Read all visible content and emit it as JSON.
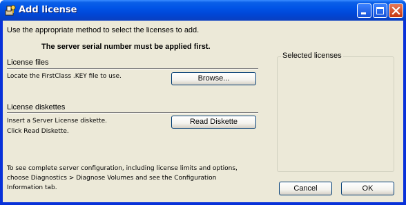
{
  "window": {
    "title": "Add license",
    "controls": {
      "minimize": "minimize",
      "maximize": "maximize",
      "close": "close"
    }
  },
  "intro": "Use the appropriate method to select the licenses to add.",
  "warning": "The server serial number must be applied first.",
  "license_files": {
    "heading": "License files",
    "instruction": "Locate the FirstClass .KEY file to use.",
    "browse_label": "Browse..."
  },
  "license_diskettes": {
    "heading": "License diskettes",
    "instruction_1": "Insert a Server License diskette.",
    "instruction_2": "Click Read Diskette.",
    "read_label": "Read Diskette"
  },
  "footer_note": {
    "line_1": "To see complete server configuration, including license limits and options,",
    "line_2": "choose Diagnostics > Diagnose Volumes and see the Configuration",
    "line_3": "Information tab."
  },
  "selected_licenses": {
    "label": "Selected licenses"
  },
  "buttons": {
    "cancel": "Cancel",
    "ok": "OK"
  },
  "colors": {
    "titlebar": "#0053e6",
    "face": "#ece9d8",
    "close": "#c2350e"
  },
  "icons": {
    "app": "app-icon",
    "minimize": "minimize-icon",
    "maximize": "maximize-icon",
    "close": "close-icon"
  }
}
